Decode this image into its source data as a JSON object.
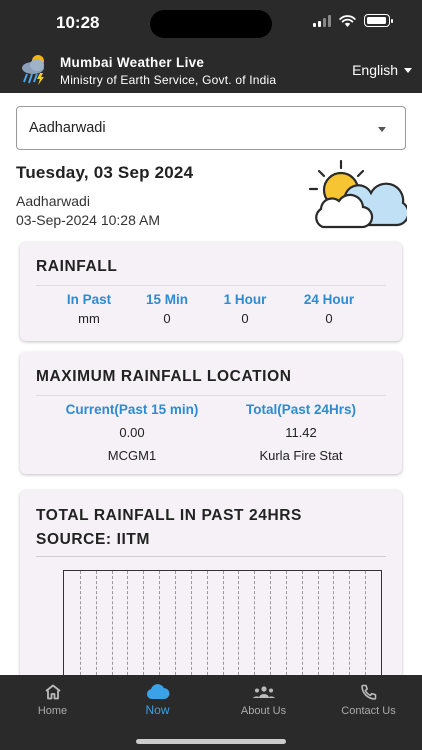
{
  "status_bar": {
    "time": "10:28"
  },
  "header": {
    "title": "Mumbai Weather Live",
    "subtitle": "Ministry of Earth Service, Govt. of India",
    "language": "English"
  },
  "location_select": {
    "value": "Aadharwadi"
  },
  "summary": {
    "date": "Tuesday, 03 Sep 2024",
    "location": "Aadharwadi",
    "timestamp": "03-Sep-2024 10:28 AM",
    "weather_icon": "partly-cloudy-icon"
  },
  "rainfall": {
    "title": "RAINFALL",
    "columns": [
      {
        "head": "In Past",
        "value": "mm"
      },
      {
        "head": "15 Min",
        "value": "0"
      },
      {
        "head": "1 Hour",
        "value": "0"
      },
      {
        "head": "24 Hour",
        "value": "0"
      }
    ]
  },
  "max_rainfall": {
    "title": "MAXIMUM RAINFALL LOCATION",
    "columns": [
      {
        "head": "Current(Past 15 min)",
        "value": "0.00",
        "location": "MCGM1"
      },
      {
        "head": "Total(Past 24Hrs)",
        "value": "11.42",
        "location": "Kurla Fire Stat"
      }
    ]
  },
  "total_rainfall": {
    "title_line1": "TOTAL RAINFALL IN PAST 24HRS",
    "title_line2": "SOURCE: IITM"
  },
  "nav": [
    {
      "label": "Home",
      "icon": "home-icon",
      "active": false
    },
    {
      "label": "Now",
      "icon": "cloud-icon",
      "active": true
    },
    {
      "label": "About Us",
      "icon": "group-icon",
      "active": false
    },
    {
      "label": "Contact Us",
      "icon": "phone-icon",
      "active": false
    }
  ],
  "colors": {
    "accent": "#2e8bd0",
    "nav_active": "#3ba2e8",
    "bar_bg": "#2a2a2a"
  }
}
